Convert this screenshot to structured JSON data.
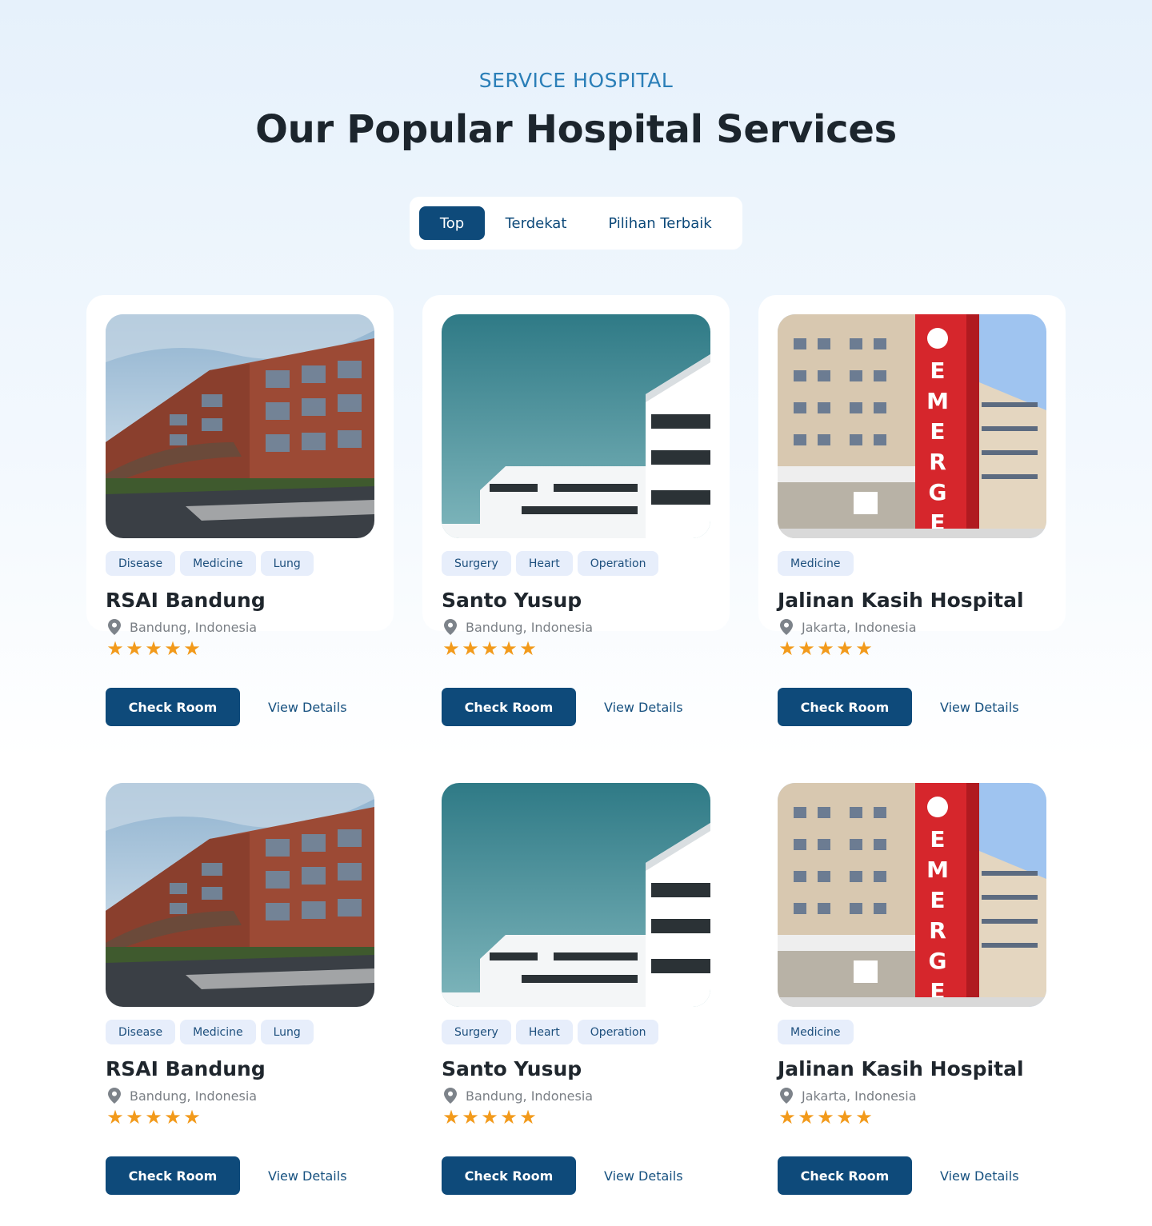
{
  "section": {
    "eyebrow": "SERVICE HOSPITAL",
    "title": "Our Popular Hospital Services"
  },
  "tabs": [
    {
      "label": "Top",
      "active": true
    },
    {
      "label": "Terdekat",
      "active": false
    },
    {
      "label": "Pilihan Terbaik",
      "active": false
    }
  ],
  "cards": [
    {
      "image": "brick-hospital-building-photo",
      "tags": [
        "Disease",
        "Medicine",
        "Lung"
      ],
      "name": "RSAI Bandung",
      "location": "Bandung, Indonesia",
      "rating": 5,
      "primary": "Check Room",
      "secondary": "View Details"
    },
    {
      "image": "white-modern-building-photo",
      "tags": [
        "Surgery",
        "Heart",
        "Operation"
      ],
      "name": "Santo Yusup",
      "location": "Bandung, Indonesia",
      "rating": 5,
      "primary": "Check Room",
      "secondary": "View Details"
    },
    {
      "image": "emergency-sign-hospital-photo",
      "tags": [
        "Medicine"
      ],
      "name": "Jalinan Kasih Hospital",
      "location": "Jakarta, Indonesia",
      "rating": 5,
      "primary": "Check Room",
      "secondary": "View Details"
    },
    {
      "image": "brick-hospital-building-photo",
      "tags": [
        "Disease",
        "Medicine",
        "Lung"
      ],
      "name": "RSAI Bandung",
      "location": "Bandung, Indonesia",
      "rating": 5,
      "primary": "Check Room",
      "secondary": "View Details"
    },
    {
      "image": "white-modern-building-photo",
      "tags": [
        "Surgery",
        "Heart",
        "Operation"
      ],
      "name": "Santo Yusup",
      "location": "Bandung, Indonesia",
      "rating": 5,
      "primary": "Check Room",
      "secondary": "View Details"
    },
    {
      "image": "emergency-sign-hospital-photo",
      "tags": [
        "Medicine"
      ],
      "name": "Jalinan Kasih Hospital",
      "location": "Jakarta, Indonesia",
      "rating": 5,
      "primary": "Check Room",
      "secondary": "View Details"
    }
  ],
  "colors": {
    "primary": "#0e4a7a",
    "accent": "#2b7fb8",
    "star": "#f29a1b",
    "tag_bg": "#e7eefb"
  },
  "icons": {
    "location": "map-pin-icon",
    "rating": "star-icon"
  }
}
